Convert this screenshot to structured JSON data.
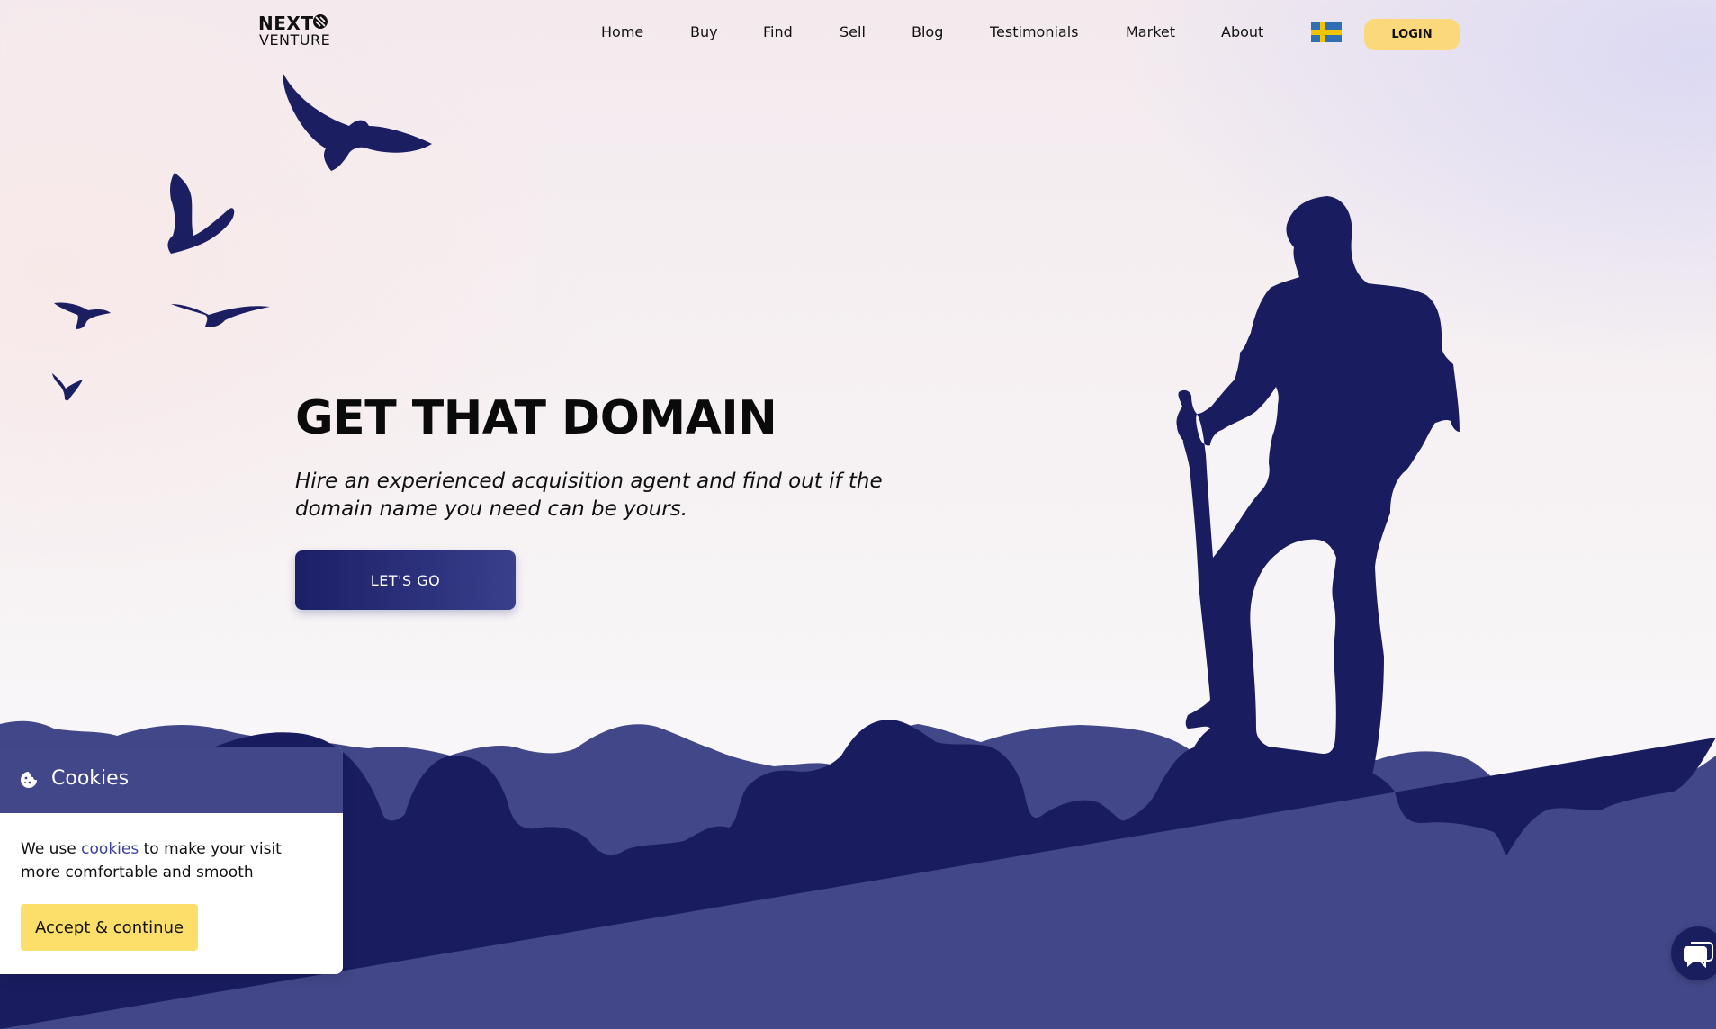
{
  "header": {
    "logo_top": "NEXT",
    "logo_bottom": "VENTURE",
    "nav": [
      "Home",
      "Buy",
      "Find",
      "Sell",
      "Blog",
      "Testimonials",
      "Market",
      "About"
    ],
    "flag_icon": "sweden-flag-icon",
    "login_label": "LOGIN"
  },
  "hero": {
    "title": "GET THAT DOMAIN",
    "subtitle": "Hire an experienced acquisition agent and find out if the domain name you need can be yours.",
    "cta_label": "LET'S GO"
  },
  "cookie_banner": {
    "icon": "cookie-icon",
    "title": "Cookies",
    "text_before": "We use ",
    "link_text": "cookies",
    "text_after": " to make your visit more comfortable and smooth",
    "accept_label": "Accept & continue"
  },
  "chat_widget": {
    "icon": "chat-bubble-icon"
  },
  "colors": {
    "navy": "#1a1e5f",
    "indigo": "#424789",
    "accent_yellow": "#fbdf6a",
    "login_yellow": "#fbd97a"
  }
}
